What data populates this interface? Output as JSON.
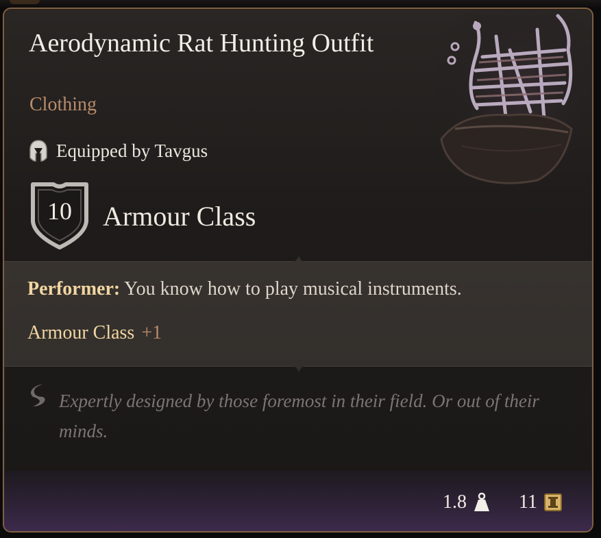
{
  "item": {
    "name": "Aerodynamic Rat Hunting Outfit",
    "category": "Clothing",
    "equipped_text": "Equipped by Tavgus",
    "armour_class_value": "10",
    "armour_class_label": "Armour Class"
  },
  "passive": {
    "keyword": "Performer:",
    "description": " You know how to play musical instruments."
  },
  "bonus": {
    "label": "Armour Class",
    "value": "+1"
  },
  "flavor_text": "Expertly designed by those foremost in their field. Or out of their minds.",
  "footer": {
    "weight": "1.8",
    "value": "11"
  },
  "icons": {
    "equipped": "helmet-icon",
    "armour": "shield-icon",
    "flavor": "quill-icon",
    "weight": "weight-icon",
    "value": "coin-icon"
  },
  "colors": {
    "border": "#7f6044",
    "title": "#f2ede6",
    "category": "#b88c6c",
    "keyword": "#f1d6a2",
    "bonus_value": "#b98b6c",
    "flavor": "#7c7672",
    "footer_purple": "#3c2a4b"
  }
}
